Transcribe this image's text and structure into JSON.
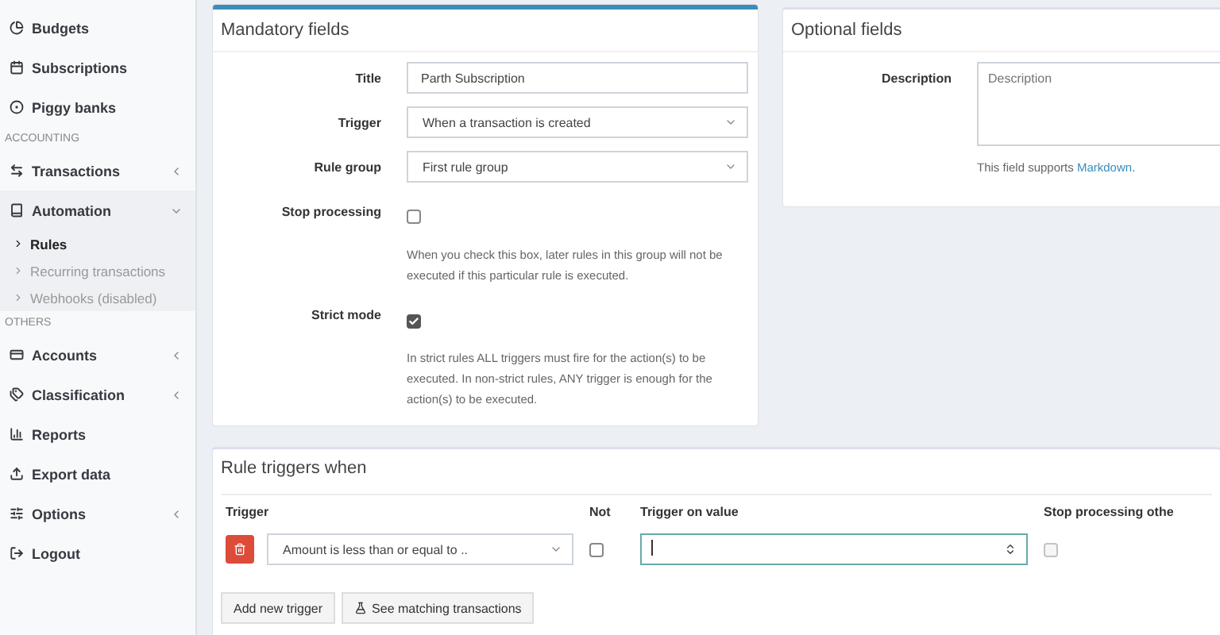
{
  "sidebar": {
    "items": [
      {
        "kind": "item",
        "label": "Budgets"
      },
      {
        "kind": "item",
        "label": "Subscriptions"
      },
      {
        "kind": "item",
        "label": "Piggy banks"
      },
      {
        "kind": "header",
        "label": "ACCOUNTING"
      },
      {
        "kind": "item",
        "label": "Transactions",
        "expanded": false
      },
      {
        "kind": "item",
        "label": "Automation",
        "expanded": true,
        "children": [
          {
            "label": "Rules",
            "selected": true
          },
          {
            "label": "Recurring transactions",
            "selected": false
          },
          {
            "label": "Webhooks (disabled)",
            "selected": false
          }
        ]
      },
      {
        "kind": "header",
        "label": "OTHERS"
      },
      {
        "kind": "item",
        "label": "Accounts",
        "expanded": false
      },
      {
        "kind": "item",
        "label": "Classification",
        "expanded": false
      },
      {
        "kind": "item",
        "label": "Reports"
      },
      {
        "kind": "item",
        "label": "Export data"
      },
      {
        "kind": "item",
        "label": "Options",
        "expanded": false
      },
      {
        "kind": "item",
        "label": "Logout"
      }
    ]
  },
  "mandatory": {
    "title": "Mandatory fields",
    "fields": [
      {
        "kind": "text",
        "label": "Title",
        "value": "Parth Subscription"
      },
      {
        "kind": "select",
        "label": "Trigger",
        "value": "When a transaction is created"
      },
      {
        "kind": "select",
        "label": "Rule group",
        "value": "First rule group"
      },
      {
        "kind": "checkbox",
        "label": "Stop processing",
        "checked": false,
        "help": "When you check this box, later rules in this group will not be executed if this particular rule is executed."
      },
      {
        "kind": "checkbox",
        "label": "Strict mode",
        "checked": true,
        "help": "In strict rules ALL triggers must fire for the action(s) to be executed. In non-strict rules, ANY trigger is enough for the action(s) to be executed."
      }
    ]
  },
  "optional": {
    "title": "Optional fields",
    "description": {
      "label": "Description",
      "placeholder": "Description",
      "help": "This field supports",
      "link": "Markdown",
      "after": "."
    }
  },
  "triggers": {
    "title": "Rule triggers when",
    "columns": [
      "Trigger",
      "Not",
      "Trigger on value",
      "Stop processing othe"
    ],
    "rows": [
      {
        "trigger": "Amount is less than or equal to ..",
        "not": false,
        "focused": true,
        "stop": false,
        "stop_disabled": true
      }
    ],
    "buttons": [
      "Add new trigger",
      "See matching transactions"
    ]
  }
}
